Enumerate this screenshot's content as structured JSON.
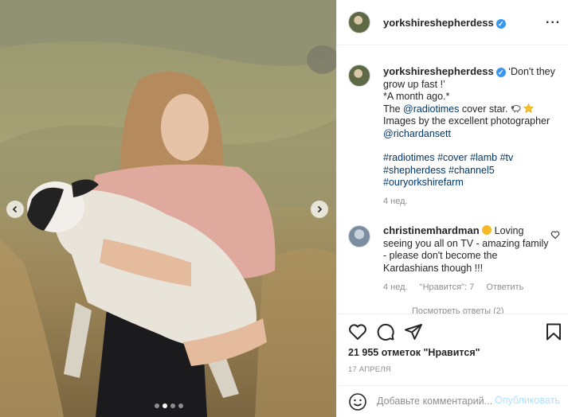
{
  "post": {
    "username": "yorkshireshepherdess",
    "more_icon": "more-horizontal-icon",
    "verified_icon": "verified-badge-icon",
    "carousel": {
      "total_images": 4,
      "active_index": 1
    }
  },
  "caption": {
    "username": "yorkshireshepherdess",
    "line1": "‘Don't they grow up fast !’",
    "line2": "*A month ago.*",
    "line3_prefix": "The ",
    "line3_mention": "@radiotimes",
    "line3_suffix": " cover star.",
    "line4": "Images by the excellent photographer",
    "line5_mention": "@richardansett",
    "tags_line1": "#radiotimes #cover #lamb #tv",
    "tags_line2": "#shepherdess #channel5",
    "tags_line3": "#ouryorkshirefarm",
    "time": "4 нед."
  },
  "comment": {
    "username": "christinemhardman",
    "text": " Loving seeing you all on TV - amazing family - please don't become the Kardashians though !!!",
    "time": "4 нед.",
    "likes": "\"Нравится\": 7",
    "reply": "Ответить",
    "view_replies": "Посмотреть ответы (2)"
  },
  "actions": {
    "likes_count": "21 955 отметок \"Нравится\"",
    "date": "17 АПРЕЛЯ"
  },
  "add_comment": {
    "placeholder": "Добавьте комментарий...",
    "post_label": "Опубликовать"
  },
  "colors": {
    "link": "#00376b",
    "verified": "#3897f0",
    "muted": "#8e8e8e",
    "post_disabled": "#b2dffc"
  }
}
